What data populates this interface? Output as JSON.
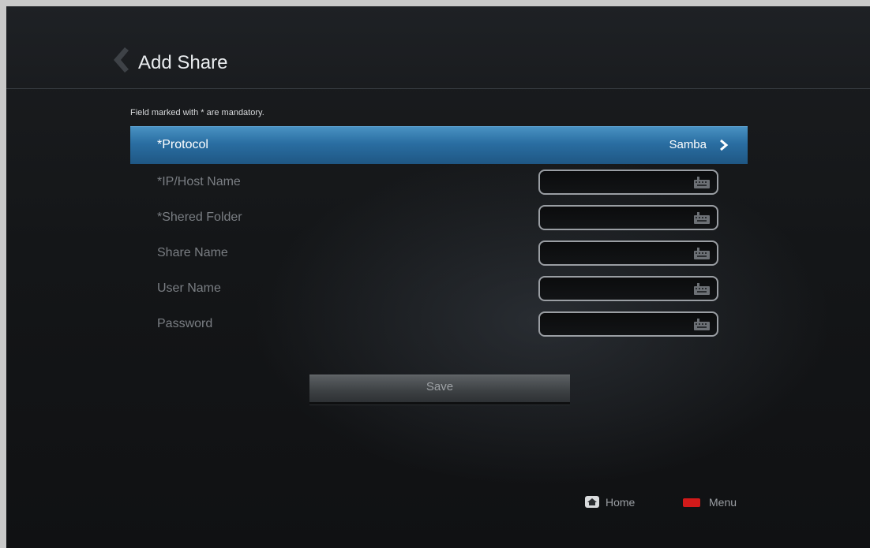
{
  "page": {
    "title": "Add Share"
  },
  "hint": "Field marked with * are mandatory.",
  "form": {
    "rows": [
      {
        "label": "*Protocol",
        "value": "Samba"
      },
      {
        "label": "*IP/Host Name",
        "value": ""
      },
      {
        "label": "*Shered Folder",
        "value": ""
      },
      {
        "label": "Share Name",
        "value": ""
      },
      {
        "label": "User Name",
        "value": ""
      },
      {
        "label": "Password",
        "value": ""
      }
    ]
  },
  "save_label": "Save",
  "footer": {
    "home_label": "Home",
    "menu_label": "Menu"
  },
  "colors": {
    "selection": "#2a6ea2",
    "menu_key": "#d11a1a",
    "background": "#141618"
  },
  "icons": [
    "back-chevron-icon",
    "chevron-right-icon",
    "keyboard-icon",
    "home-icon",
    "menu-key-icon"
  ]
}
